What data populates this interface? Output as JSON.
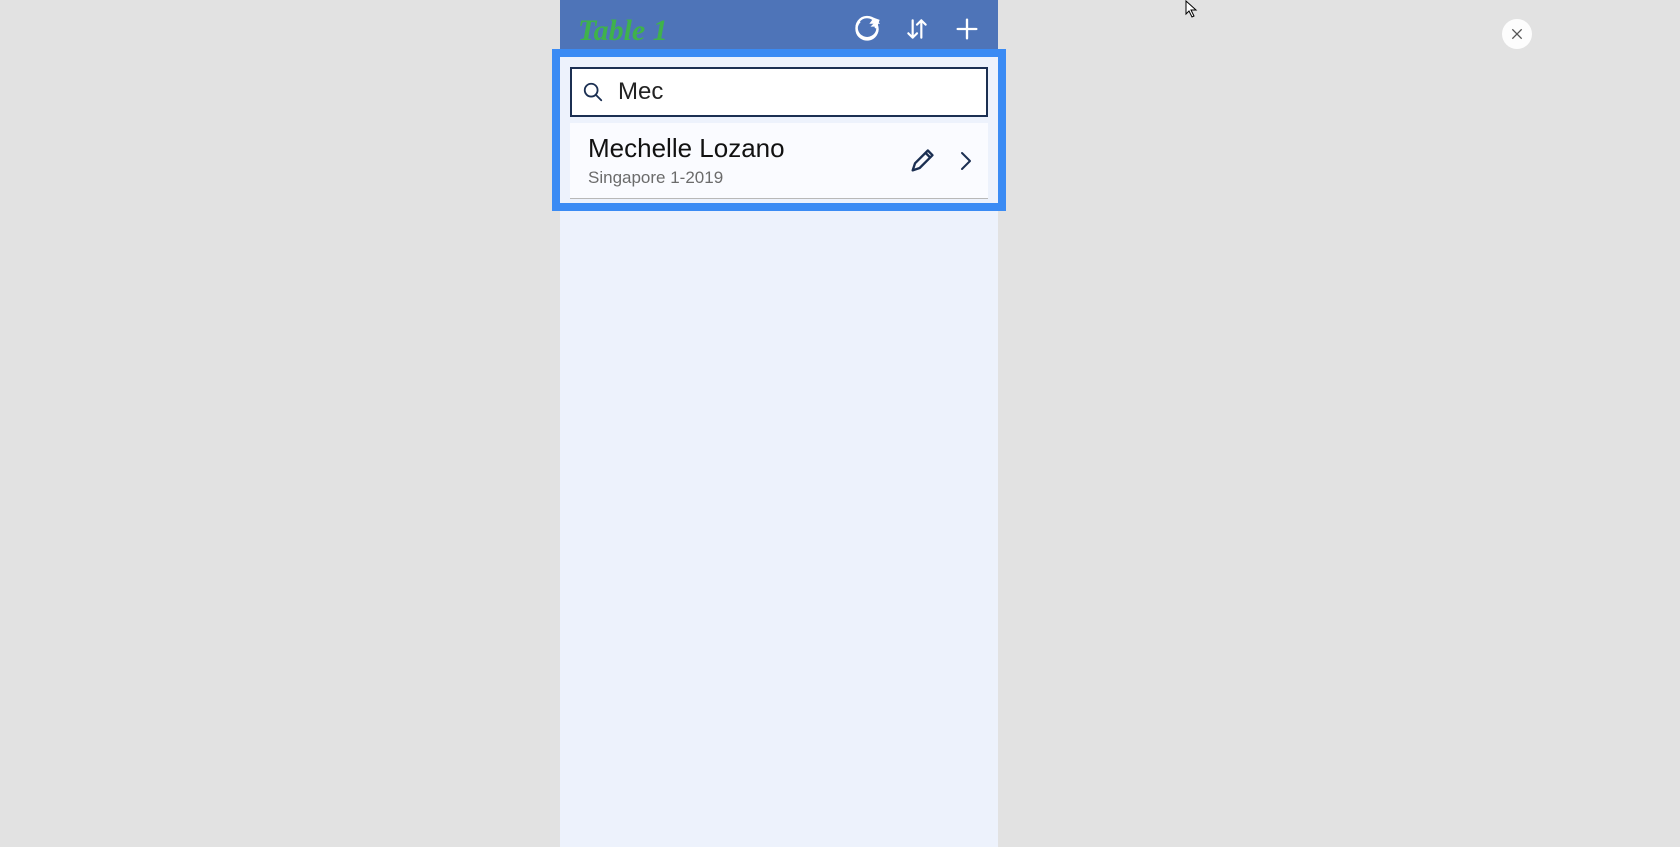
{
  "header": {
    "title": "Table 1"
  },
  "search": {
    "value": "Mec",
    "placeholder": ""
  },
  "results": [
    {
      "name": "Mechelle Lozano",
      "sub": "Singapore 1-2019"
    }
  ],
  "colors": {
    "headerBg": "#4e74b8",
    "titleGreen": "#3fb24b",
    "highlight": "#3a8bf4",
    "darkNavy": "#1b2f52"
  }
}
